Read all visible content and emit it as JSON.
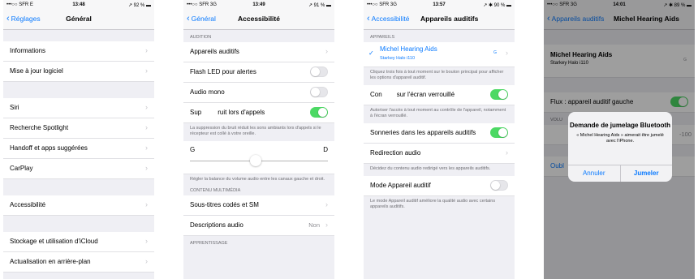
{
  "screen1": {
    "status": {
      "carrier": "•••○○ SFR  E",
      "time": "13:48",
      "battery": "↗ 92 % ▬"
    },
    "back": "Réglages",
    "title": "Général",
    "items": [
      "Informations",
      "Mise à jour logiciel",
      "Siri",
      "Recherche Spotlight",
      "Handoff et apps suggérées",
      "CarPlay",
      "Accessibilité",
      "Stockage et utilisation d'iCloud",
      "Actualisation en arrière-plan"
    ]
  },
  "screen2": {
    "status": {
      "carrier": "•••○○ SFR  3G",
      "time": "13:49",
      "battery": "↗ 91 % ▬"
    },
    "back": "Général",
    "title": "Accessibilité",
    "section_audition": "AUDITION",
    "hearing_devices": "Appareils auditifs",
    "flash_led": "Flash LED pour alertes",
    "mono_audio": "Audio mono",
    "noise_cancel_a": "Sup",
    "noise_cancel_b": "ruit lors d'appels",
    "noise_footer": "La suppression du bruit réduit les sons ambiants lors d'appels si le récepteur est collé à votre oreille.",
    "slider_left": "G",
    "slider_right": "D",
    "balance_footer": "Régler la balance du volume audio entre les canaux gauche et droit.",
    "section_media": "CONTENU MULTIMÉDIA",
    "subtitles": "Sous-titres codés et SM",
    "audio_desc": "Descriptions audio",
    "audio_desc_value": "Non",
    "section_learning": "APPRENTISSAGE",
    "toggles": {
      "flash_led": false,
      "mono_audio": false,
      "noise_cancel": true
    }
  },
  "screen3": {
    "status": {
      "carrier": "•••○○ SFR  3G",
      "time": "13:57",
      "battery": "↗ ✱ 90 % ▬"
    },
    "back": "Accessibilité",
    "title": "Appareils auditifs",
    "section_devices": "APPAREILS",
    "device_name": "Michel Hearing Aids",
    "device_model": "Starkey Halo i110",
    "device_batt": "G",
    "triple_click_footer": "Cliquez trois fois à tout moment sur le bouton principal pour afficher les options d'appareil auditif.",
    "lock_screen_a": "Con",
    "lock_screen_b": "sur l'écran verrouillé",
    "lock_footer": "Autoriser l'accès à tout moment au contrôle de l'appareil, notamment à l'écran verrouillé.",
    "ringtones": "Sonneries dans les appareils auditifs",
    "audio_routing": "Redirection audio",
    "routing_footer": "Décidez du contenu audio redirigé vers les appareils auditifs.",
    "hearing_mode": "Mode Appareil auditif",
    "mode_footer": "Le mode Appareil auditif améliore la qualité audio avec certains appareils auditifs.",
    "toggles": {
      "lock_screen": true,
      "ringtones": true,
      "hearing_mode": false
    }
  },
  "screen4": {
    "status": {
      "carrier": "•••○○ SFR  3G",
      "time": "14:01",
      "battery": "↗ ✱ 89 % ▬"
    },
    "back": "Appareils auditifs",
    "title": "Michel Hearing Aids",
    "device_name": "Michel Hearing Aids",
    "device_model": "Starkey Halo i110",
    "device_batt": "G",
    "stream": "Flux : appareil auditif gauche",
    "volume_label": "VOLU",
    "volume_right": "-100",
    "forget": "Oubl",
    "alert_title": "Demande de jumelage Bluetooth",
    "alert_message": "« Michel Hearing Aids » aimerait être jumelé avec l'iPhone.",
    "alert_cancel": "Annuler",
    "alert_pair": "Jumeler",
    "toggles": {
      "stream": true
    }
  },
  "colors": {
    "accent": "#0a7aff",
    "toggle_on": "#4cd964",
    "group_bg": "#efeff4"
  }
}
